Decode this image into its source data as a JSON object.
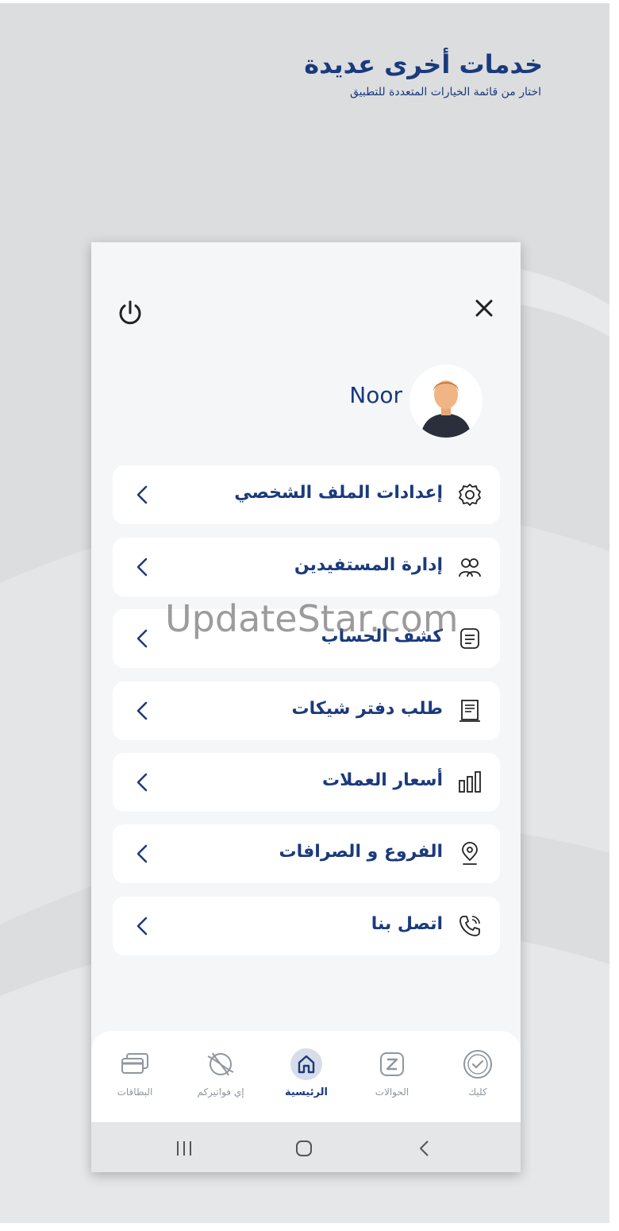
{
  "promo": {
    "title": "خدمات أخرى عديدة",
    "subtitle": "اختار من قائمة الخيارات المتعددة للتطبيق"
  },
  "header": {
    "power_icon": "power-icon",
    "close_icon": "close-icon"
  },
  "profile": {
    "name": "Noor",
    "avatar_icon": "user-avatar"
  },
  "menu": {
    "items": [
      {
        "label": "إعدادات الملف الشخصي",
        "icon": "gear-icon"
      },
      {
        "label": "إدارة المستفيدين",
        "icon": "users-icon"
      },
      {
        "label": "كشف الحساب",
        "icon": "statement-icon"
      },
      {
        "label": "طلب دفتر شيكات",
        "icon": "checkbook-icon"
      },
      {
        "label": "أسعار العملات",
        "icon": "bar-chart-icon"
      },
      {
        "label": "الفروع و الصرافات",
        "icon": "location-pin-icon"
      },
      {
        "label": "اتصل بنا",
        "icon": "phone-icon"
      }
    ]
  },
  "bottom_nav": {
    "items": [
      {
        "label": "البطاقات",
        "icon": "card-icon"
      },
      {
        "label": "إي فواتيركم",
        "icon": "globe-bill-icon"
      },
      {
        "label": "الرئيسية",
        "icon": "home-icon",
        "active": true
      },
      {
        "label": "الحوالات",
        "icon": "transfer-icon"
      },
      {
        "label": "كليك",
        "icon": "cliq-icon"
      }
    ]
  },
  "system_bar": {
    "recents_icon": "recents-icon",
    "home_icon": "system-home-icon",
    "back_icon": "back-icon"
  },
  "watermark": "UpdateStar.com",
  "colors": {
    "primary": "#1a3a7c",
    "background": "#dcdddf",
    "card": "#ffffff",
    "muted": "#8f969e"
  }
}
